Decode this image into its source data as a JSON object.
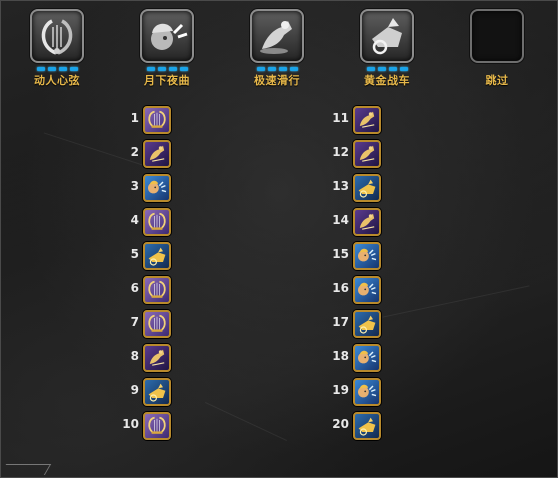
{
  "skills": [
    {
      "id": "lyre",
      "label": "动人心弦",
      "icon": "lyre-icon",
      "level": 4
    },
    {
      "id": "serenade",
      "label": "月下夜曲",
      "icon": "serenade-icon",
      "level": 4
    },
    {
      "id": "glide",
      "label": "极速滑行",
      "icon": "glide-icon",
      "level": 4
    },
    {
      "id": "chariot",
      "label": "黄金战车",
      "icon": "chariot-icon",
      "level": 4
    },
    {
      "id": "skip",
      "label": "跳过",
      "icon": "",
      "level": 0
    }
  ],
  "order_left": [
    {
      "num": "1",
      "skill": "lyre"
    },
    {
      "num": "2",
      "skill": "glide"
    },
    {
      "num": "3",
      "skill": "serenade"
    },
    {
      "num": "4",
      "skill": "lyre"
    },
    {
      "num": "5",
      "skill": "chariot"
    },
    {
      "num": "6",
      "skill": "lyre"
    },
    {
      "num": "7",
      "skill": "lyre"
    },
    {
      "num": "8",
      "skill": "glide"
    },
    {
      "num": "9",
      "skill": "chariot"
    },
    {
      "num": "10",
      "skill": "lyre"
    }
  ],
  "order_right": [
    {
      "num": "11",
      "skill": "glide"
    },
    {
      "num": "12",
      "skill": "glide"
    },
    {
      "num": "13",
      "skill": "chariot"
    },
    {
      "num": "14",
      "skill": "glide"
    },
    {
      "num": "15",
      "skill": "serenade"
    },
    {
      "num": "16",
      "skill": "serenade"
    },
    {
      "num": "17",
      "skill": "chariot"
    },
    {
      "num": "18",
      "skill": "serenade"
    },
    {
      "num": "19",
      "skill": "serenade"
    },
    {
      "num": "20",
      "skill": "chariot"
    }
  ],
  "colors": {
    "label_gold": "#e7b84a",
    "level_pip_blue": "#1aa3e8",
    "number_white": "#e8e8e8",
    "icon_border_gold": "#b88a2c"
  }
}
